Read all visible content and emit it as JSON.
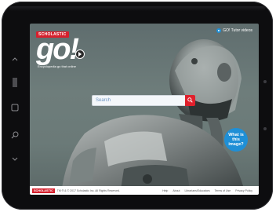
{
  "device": {
    "side_icons": [
      "chevron-up-icon",
      "menu-lines-icon",
      "square-icon",
      "search-icon",
      "chevron-down-icon"
    ]
  },
  "header": {
    "brand_tag": "SCHOLASTIC",
    "brand_name": "go!",
    "tagline": "Encyclopedia go that online",
    "video_link": "GO! Tutor videos"
  },
  "search": {
    "placeholder": "Search"
  },
  "badge": {
    "label": "What is this image?"
  },
  "footer": {
    "logo": "SCHOLASTIC",
    "copyright": "TM ® & © 2017 Scholastic Inc. All Rights Reserved.",
    "links": [
      "Help",
      "About",
      "Librarians/Educators",
      "Terms of Use",
      "Privacy Policy"
    ]
  },
  "colors": {
    "brand_red": "#d6202d",
    "accent_blue": "#1f8fd6",
    "bezel": "#0d0d0f"
  }
}
